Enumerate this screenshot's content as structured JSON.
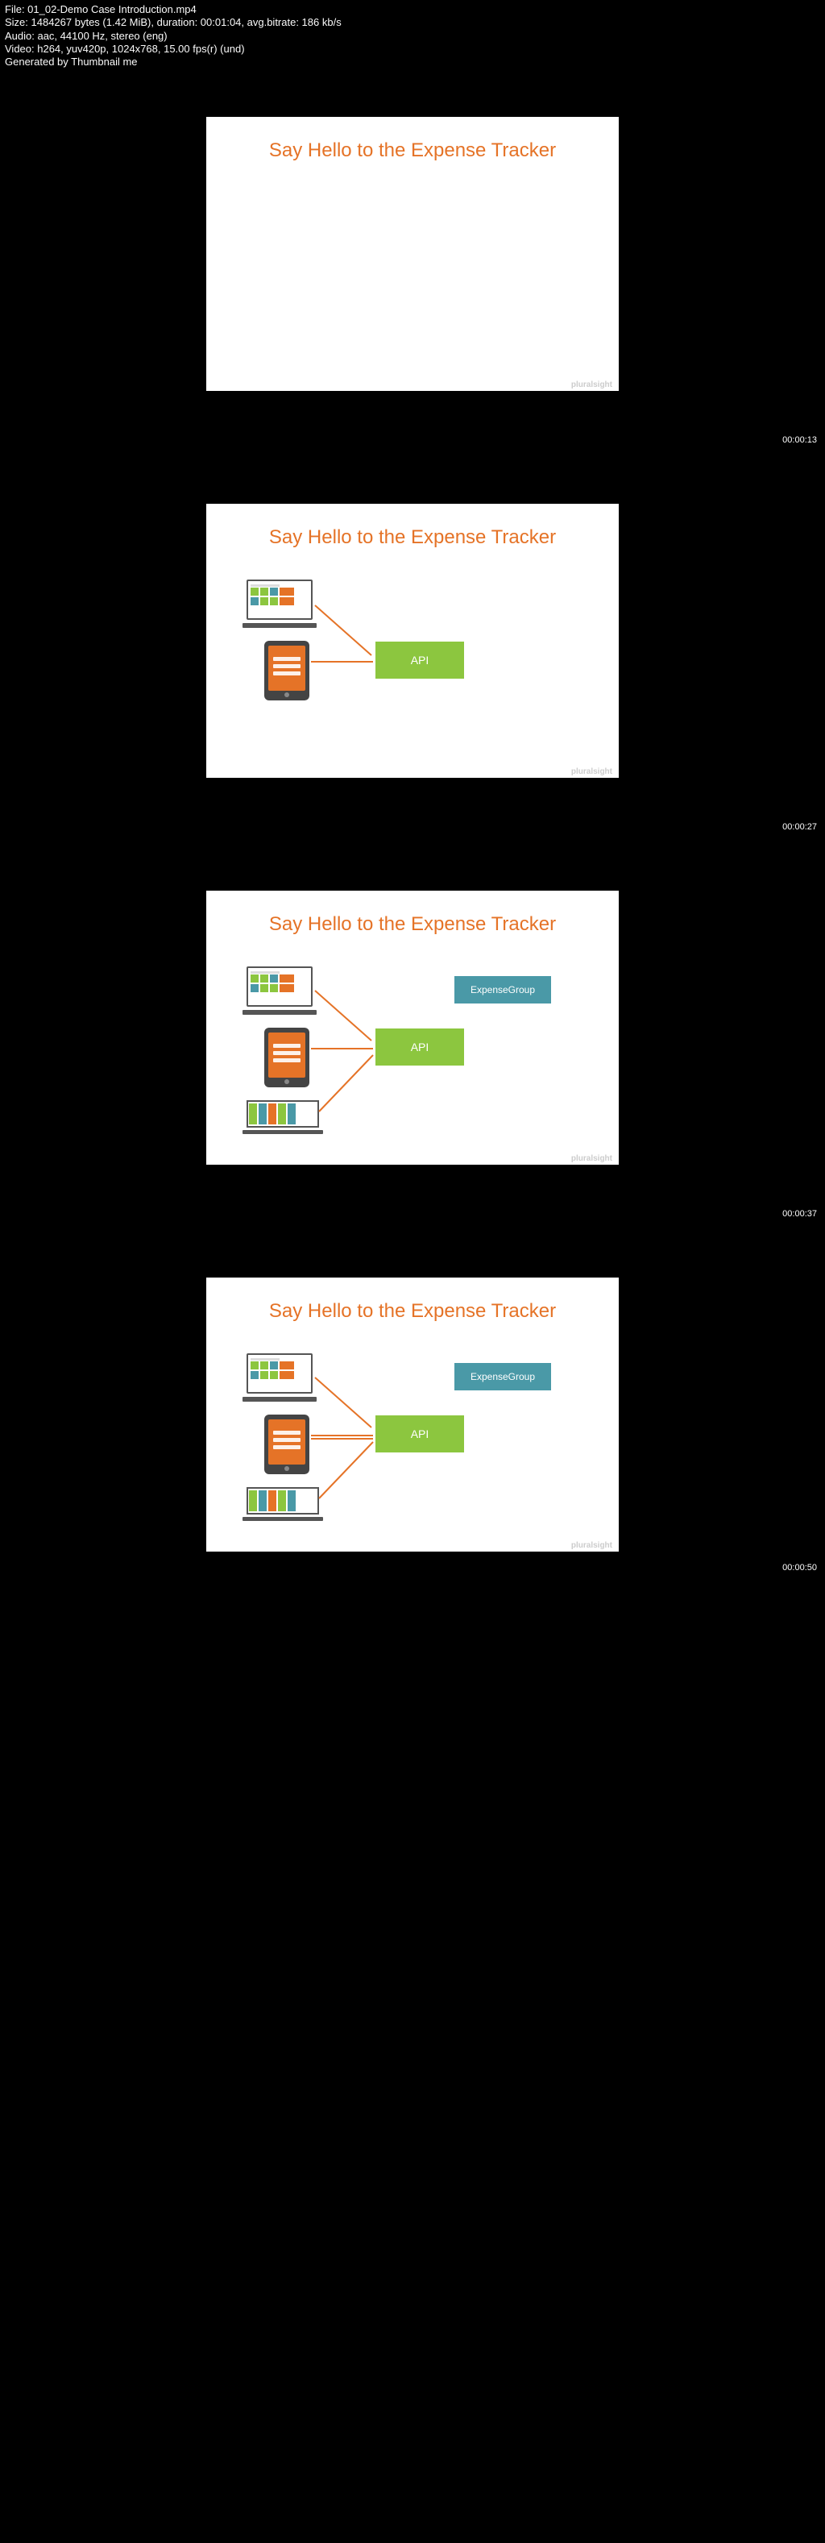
{
  "meta": {
    "file": "File: 01_02-Demo Case Introduction.mp4",
    "size": "Size: 1484267 bytes (1.42 MiB), duration: 00:01:04, avg.bitrate: 186 kb/s",
    "audio": "Audio: aac, 44100 Hz, stereo (eng)",
    "video": "Video: h264, yuv420p, 1024x768, 15.00 fps(r) (und)",
    "gen": "Generated by Thumbnail me"
  },
  "title_text": "Say Hello to the Expense Tracker",
  "watermark": "pluralsight",
  "api_label": "API",
  "entity_label": "ExpenseGroup",
  "timestamps": {
    "t1": "00:00:13",
    "t2": "00:00:27",
    "t3": "00:00:37",
    "t4": "00:00:50"
  }
}
